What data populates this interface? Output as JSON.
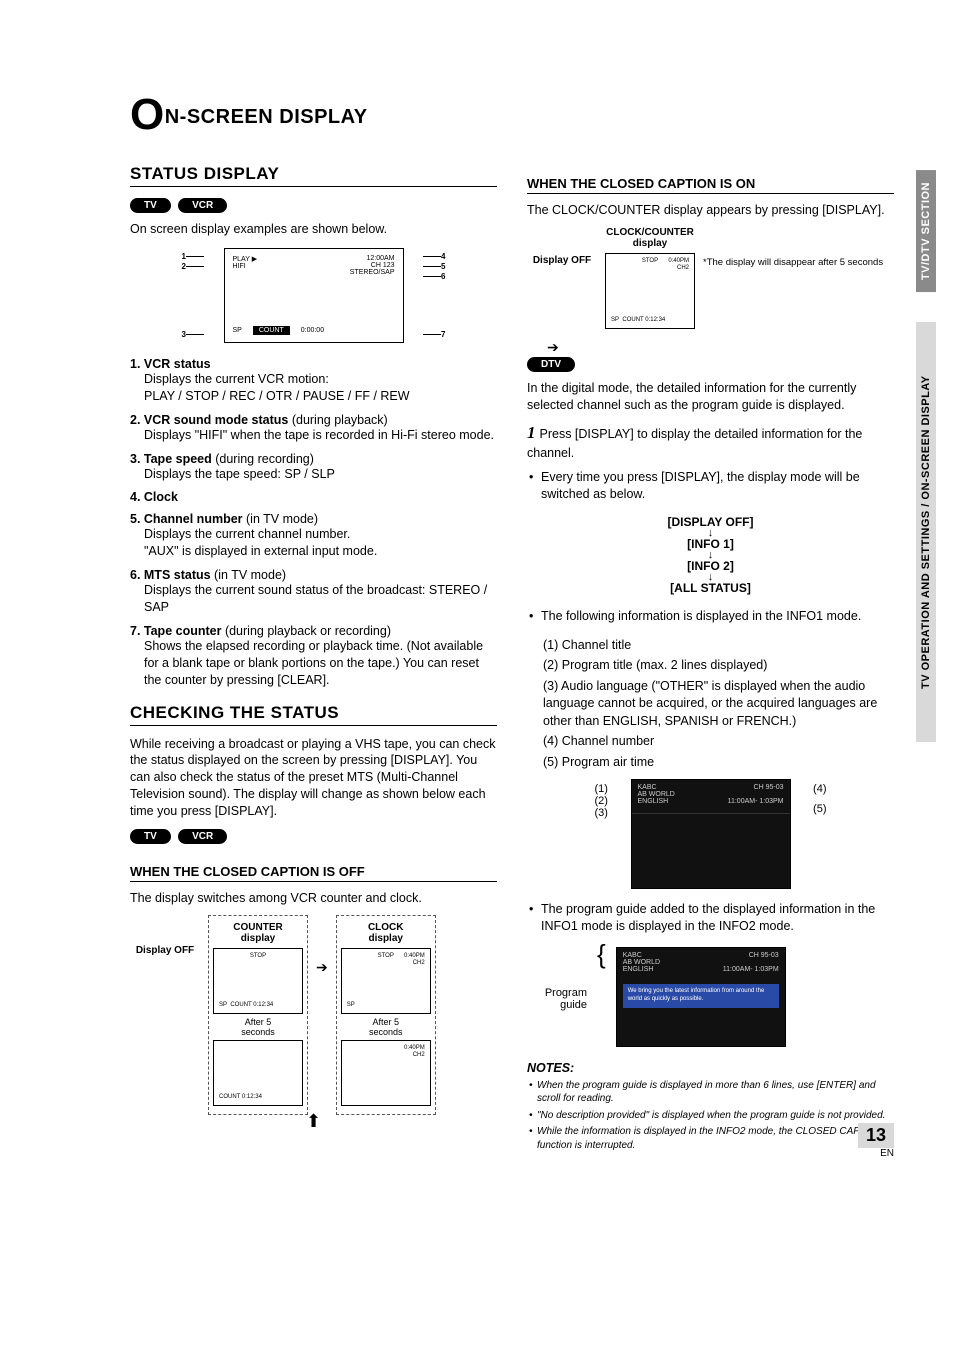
{
  "side_tabs": {
    "top": "TV/DTV SECTION",
    "bottom": "TV OPERATION AND SETTINGS / ON-SCREEN DISPLAY"
  },
  "title": {
    "big": "O",
    "rest": "N-SCREEN DISPLAY"
  },
  "status": {
    "heading": "STATUS DISPLAY",
    "pills": [
      "TV",
      "VCR"
    ],
    "intro": "On screen display examples are shown below.",
    "osd": {
      "play": "PLAY ▶",
      "hifi": "HIFI",
      "clock": "12:00AM",
      "ch": "CH 123",
      "mts": "STEREO/SAP",
      "sp": "SP",
      "count_label": "COUNT",
      "count_val": "0:00:00",
      "num": {
        "n1": "1",
        "n2": "2",
        "n3": "3",
        "n4": "4",
        "n5": "5",
        "n6": "6",
        "n7": "7"
      }
    },
    "items": [
      {
        "title": "1. VCR status",
        "sub": "",
        "desc": "Displays the current VCR motion:\nPLAY / STOP / REC / OTR / PAUSE / FF / REW"
      },
      {
        "title": "2. VCR sound mode status",
        "sub": " (during playback)",
        "desc": "Displays \"HIFI\" when the tape is recorded in Hi-Fi stereo mode."
      },
      {
        "title": "3. Tape speed",
        "sub": " (during recording)",
        "desc": "Displays the tape speed: SP / SLP"
      },
      {
        "title": "4. Clock",
        "sub": "",
        "desc": ""
      },
      {
        "title": "5. Channel number",
        "sub": " (in TV mode)",
        "desc": "Displays the current channel number.\n\"AUX\" is displayed in external input mode."
      },
      {
        "title": "6. MTS status",
        "sub": " (in TV mode)",
        "desc": "Displays the current sound status of the broadcast: STEREO / SAP"
      },
      {
        "title": "7. Tape counter",
        "sub": " (during playback or recording)",
        "desc": "Shows the elapsed recording or playback time. (Not available for a blank tape or blank portions on the tape.) You can reset the counter by pressing [CLEAR]."
      }
    ]
  },
  "checking": {
    "heading": "CHECKING THE STATUS",
    "intro": "While receiving a broadcast or playing a VHS tape, you can check the status displayed on the screen by pressing [DISPLAY]. You can also check the status of the preset MTS (Multi-Channel Television sound). The display will change as shown below each time you press [DISPLAY].",
    "pills": [
      "TV",
      "VCR"
    ],
    "cc_off_title": "WHEN THE CLOSED CAPTION IS OFF",
    "cc_off_intro": "The display switches among VCR counter and clock.",
    "labels": {
      "display_off": "Display OFF",
      "counter": "COUNTER\ndisplay",
      "clock": "CLOCK\ndisplay",
      "after5": "After 5\nseconds"
    },
    "mini": {
      "stop": "STOP",
      "sp": "SP",
      "count": "COUNT 0:12:34",
      "time": "0:40PM",
      "ch": "CH2"
    }
  },
  "closed_on": {
    "title": "WHEN THE CLOSED CAPTION IS ON",
    "intro": "The CLOCK/COUNTER display appears by pressing [DISPLAY].",
    "labels": {
      "display_off": "Display OFF",
      "clock_counter": "CLOCK/COUNTER\ndisplay"
    },
    "note": "*The display will disappear after 5 seconds",
    "mini": {
      "stop": "STOP",
      "time": "0:40PM",
      "ch": "CH2",
      "sp": "SP",
      "count": "COUNT 0:12:34"
    },
    "dtv_pill": "DTV",
    "dtv_intro": "In the digital mode, the detailed information for the currently selected channel such as the program guide is displayed.",
    "step1": "Press [DISPLAY] to display the detailed information for the channel.",
    "step1_bullet": "Every time you press [DISPLAY], the display mode will be switched as below.",
    "cycle": [
      "[DISPLAY OFF]",
      "[INFO 1]",
      "[INFO 2]",
      "[ALL STATUS]"
    ],
    "info1_intro": "The following information is displayed in the INFO1 mode.",
    "info1_items": [
      "(1) Channel title",
      "(2) Program title (max. 2 lines displayed)",
      "(3) Audio language (\"OTHER\" is displayed when the audio language cannot be acquired, or the acquired languages are other than ENGLISH, SPANISH or FRENCH.)",
      "(4) Channel number",
      "(5) Program air time"
    ],
    "info1_screen": {
      "ch_title": "KABC",
      "ch_num": "CH 95-03",
      "prog": "AB WORLD",
      "lang": "ENGLISH",
      "air": "11:00AM- 1:03PM"
    },
    "callouts": {
      "c1": "(1)",
      "c2": "(2)",
      "c3": "(3)",
      "c4": "(4)",
      "c5": "(5)"
    },
    "info2_intro": "The program guide added to the displayed information in the INFO1 mode is displayed in the INFO2 mode.",
    "info2_label": "Program\nguide",
    "info2_guide": "We bring you the latest information from around the world as quickly as possible.",
    "notes_title": "NOTES:",
    "notes": [
      "When the program guide is displayed in more than 6 lines, use [ENTER] and scroll for reading.",
      "\"No description provided\" is displayed when the program guide is not provided.",
      "While the information is displayed in the INFO2 mode, the CLOSED CAPTION function is interrupted."
    ]
  },
  "page": {
    "num": "13",
    "lang": "EN"
  }
}
